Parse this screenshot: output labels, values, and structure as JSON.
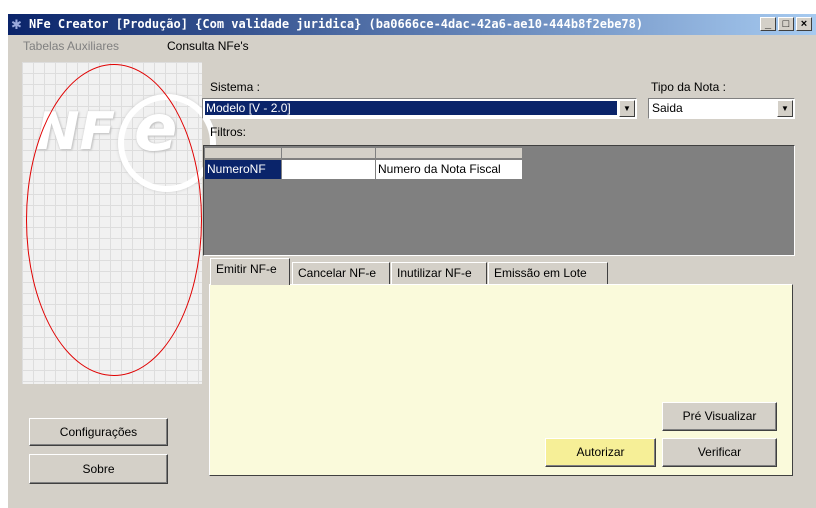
{
  "window": {
    "title": "NFe Creator [Produção] {Com validade juridica} (ba0666ce-4dac-42a6-ae10-444b8f2ebe78)",
    "minimize_glyph": "_",
    "maximize_glyph": "□",
    "close_glyph": "×"
  },
  "menu": {
    "items": [
      "Tabelas Auxiliares",
      "Consulta NFe's"
    ]
  },
  "logo": {
    "nf_text": "NF",
    "e_text": "e"
  },
  "sistema": {
    "label": "Sistema :",
    "value": "Modelo [V - 2.0]"
  },
  "tipo_nota": {
    "label": "Tipo da Nota :",
    "value": "Saida"
  },
  "filtros": {
    "label": "Filtros:",
    "row": [
      "NumeroNF",
      "",
      "Numero da Nota Fiscal"
    ]
  },
  "tabs": [
    "Emitir NF-e",
    "Cancelar NF-e",
    "Inutilizar NF-e",
    "Emissão em Lote"
  ],
  "buttons": {
    "configuracoes": "Configurações",
    "sobre": "Sobre",
    "pre_visualizar": "Pré Visualizar",
    "autorizar": "Autorizar",
    "verificar": "Verificar"
  },
  "colors": {
    "titlebar_start": "#0a246a",
    "titlebar_end": "#a6caf0",
    "selection": "#0a246a",
    "tab_panel": "#fafadb",
    "autorizar_button": "#f6ef97",
    "annotation_ellipse": "#e00000"
  }
}
